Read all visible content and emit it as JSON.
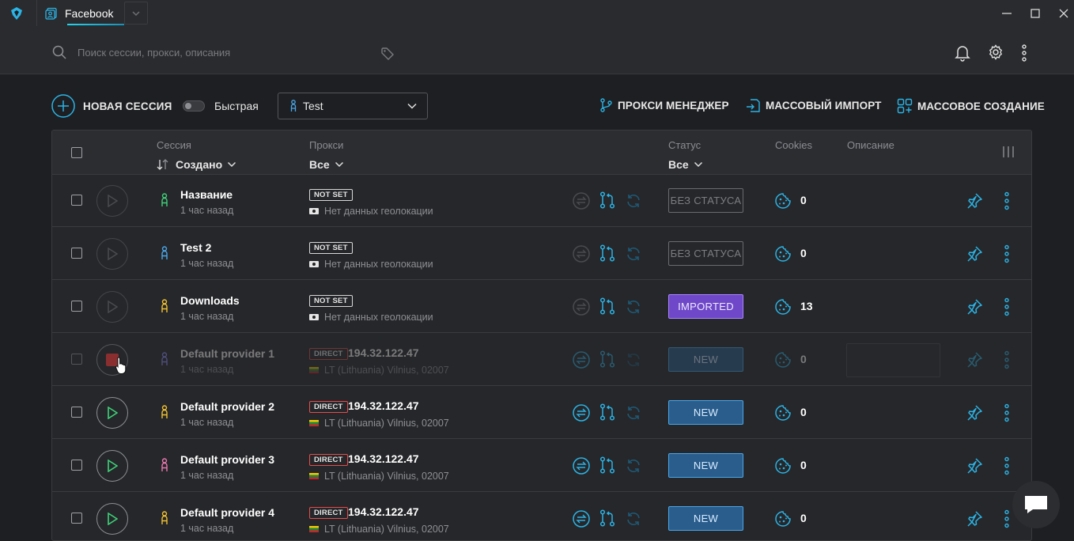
{
  "titlebar": {
    "tab_label": "Facebook"
  },
  "search": {
    "placeholder": "Поиск сессии, прокси, описания"
  },
  "toolbar": {
    "new_session": "НОВАЯ СЕССИЯ",
    "quick_label": "Быстрая",
    "group_value": "Test",
    "proxy_manager": "ПРОКСИ МЕНЕДЖЕР",
    "mass_import": "МАССОВЫЙ ИМПОРТ",
    "mass_create": "МАССОВОЕ СОЗДАНИЕ"
  },
  "table": {
    "headers": {
      "session": "Сессия",
      "session_sort": "Создано",
      "proxy": "Прокси",
      "proxy_filter": "Все",
      "status": "Статус",
      "status_filter": "Все",
      "cookies": "Cookies",
      "description": "Описание"
    },
    "rows": [
      {
        "name": "Название",
        "time": "1 час назад",
        "proxy_type": "NOT SET",
        "proxy_ip": "",
        "geo": "Нет данных геолокации",
        "status": "БЕЗ СТАТУСА",
        "cookies": "0",
        "icon_color": "#3fd27a",
        "running": false
      },
      {
        "name": "Test 2",
        "time": "1 час назад",
        "proxy_type": "NOT SET",
        "proxy_ip": "",
        "geo": "Нет данных геолокации",
        "status": "БЕЗ СТАТУСА",
        "cookies": "0",
        "icon_color": "#4aa7e9",
        "running": false
      },
      {
        "name": "Downloads",
        "time": "1 час назад",
        "proxy_type": "NOT SET",
        "proxy_ip": "",
        "geo": "Нет данных геолокации",
        "status": "IMPORTED",
        "cookies": "13",
        "icon_color": "#f2c230",
        "running": false
      },
      {
        "name": "Default provider 1",
        "time": "1 час назад",
        "proxy_type": "DIRECT",
        "proxy_ip": "194.32.122.47",
        "geo": "LT (Lithuania) Vilnius, 02007",
        "status": "NEW",
        "cookies": "0",
        "icon_color": "#8f8cff",
        "running": true
      },
      {
        "name": "Default provider 2",
        "time": "1 час назад",
        "proxy_type": "DIRECT",
        "proxy_ip": "194.32.122.47",
        "geo": "LT (Lithuania) Vilnius, 02007",
        "status": "NEW",
        "cookies": "0",
        "icon_color": "#f2c230",
        "running": false
      },
      {
        "name": "Default provider 3",
        "time": "1 час назад",
        "proxy_type": "DIRECT",
        "proxy_ip": "194.32.122.47",
        "geo": "LT (Lithuania) Vilnius, 02007",
        "status": "NEW",
        "cookies": "0",
        "icon_color": "#e979b0",
        "running": false
      },
      {
        "name": "Default provider 4",
        "time": "1 час назад",
        "proxy_type": "DIRECT",
        "proxy_ip": "194.32.122.47",
        "geo": "LT (Lithuania) Vilnius, 02007",
        "status": "NEW",
        "cookies": "0",
        "icon_color": "#f2c230",
        "running": false
      }
    ]
  },
  "colors": {
    "accent": "#2bb4e6",
    "background": "#1e1f22",
    "panel": "#2a2b2e",
    "status_new": "#2a5d8c",
    "status_imported": "#6e48c8",
    "direct_badge": "#e74c4c",
    "play_green": "#3fd27a"
  },
  "icons": [
    "app-logo-icon",
    "profile-tab-icon",
    "chevron-down-icon",
    "minimize-icon",
    "maximize-icon",
    "close-icon",
    "search-icon",
    "tag-icon",
    "bell-icon",
    "gear-icon",
    "more-vertical-icon",
    "plus-circle-icon",
    "person-icon",
    "proxy-manager-icon",
    "import-icon",
    "mass-create-icon",
    "sort-icon",
    "columns-icon",
    "play-icon",
    "stop-icon",
    "swap-icon",
    "git-branch-icon",
    "refresh-icon",
    "cookie-icon",
    "pin-icon",
    "chat-icon"
  ]
}
